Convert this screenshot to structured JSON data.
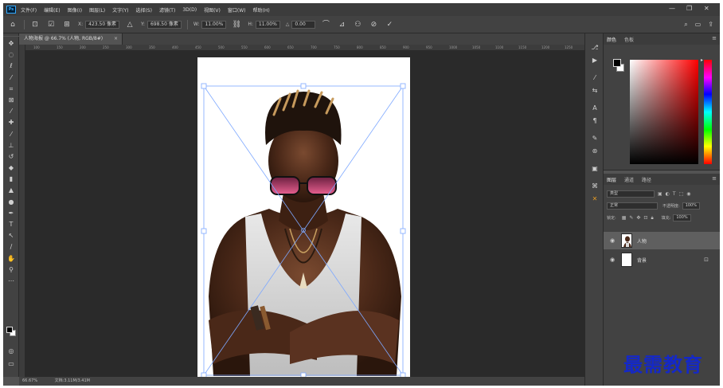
{
  "app": {
    "logo": "Ps"
  },
  "menu": {
    "items": [
      "文件(F)",
      "编辑(E)",
      "图像(I)",
      "图层(L)",
      "文字(Y)",
      "选择(S)",
      "滤镜(T)",
      "3D(D)",
      "视图(V)",
      "窗口(W)",
      "帮助(H)"
    ]
  },
  "window_controls": {
    "minimize": "—",
    "restore": "❐",
    "close": "✕"
  },
  "options": {
    "x_label": "X:",
    "x_value": "423.50 像素",
    "y_label": "Y:",
    "y_value": "698.50 像素",
    "w_label": "W:",
    "w_value": "11.00%",
    "h_label": "H:",
    "h_value": "11.00%",
    "angle_label": "△",
    "angle_value": "0.00",
    "cancel_icon": "cancel-transform-icon",
    "commit_icon": "commit-transform-icon"
  },
  "document_tab": {
    "title": "人物海报 @ 66.7% (人物, RGB/8#)",
    "close": "×"
  },
  "status": {
    "zoom": "66.67%",
    "info": "文档:3.11M/3.41M"
  },
  "ruler_numbers": [
    "100",
    "150",
    "200",
    "250",
    "300",
    "350",
    "400",
    "450",
    "500",
    "550",
    "600",
    "650",
    "700",
    "750",
    "800",
    "850",
    "900",
    "950",
    "1000",
    "1050",
    "1100",
    "1150",
    "1200",
    "1250"
  ],
  "color_panel": {
    "tabs": [
      "颜色",
      "色板"
    ],
    "menu": "≡"
  },
  "layers_panel": {
    "tabs": [
      "图层",
      "通道",
      "路径"
    ],
    "menu": "≡",
    "filter_label": "类型",
    "blend_mode": "正常",
    "opacity_label": "不透明度:",
    "opacity_value": "100%",
    "lock_label": "锁定:",
    "fill_label": "填充:",
    "fill_value": "100%",
    "layers": [
      {
        "name": "人物",
        "selected": true
      },
      {
        "name": "背景",
        "selected": false
      }
    ]
  },
  "watermark": "最需教育",
  "colors": {
    "accent": "#31a8ff",
    "transform_box": "#7da8ff",
    "watermark": "#1428c8"
  }
}
